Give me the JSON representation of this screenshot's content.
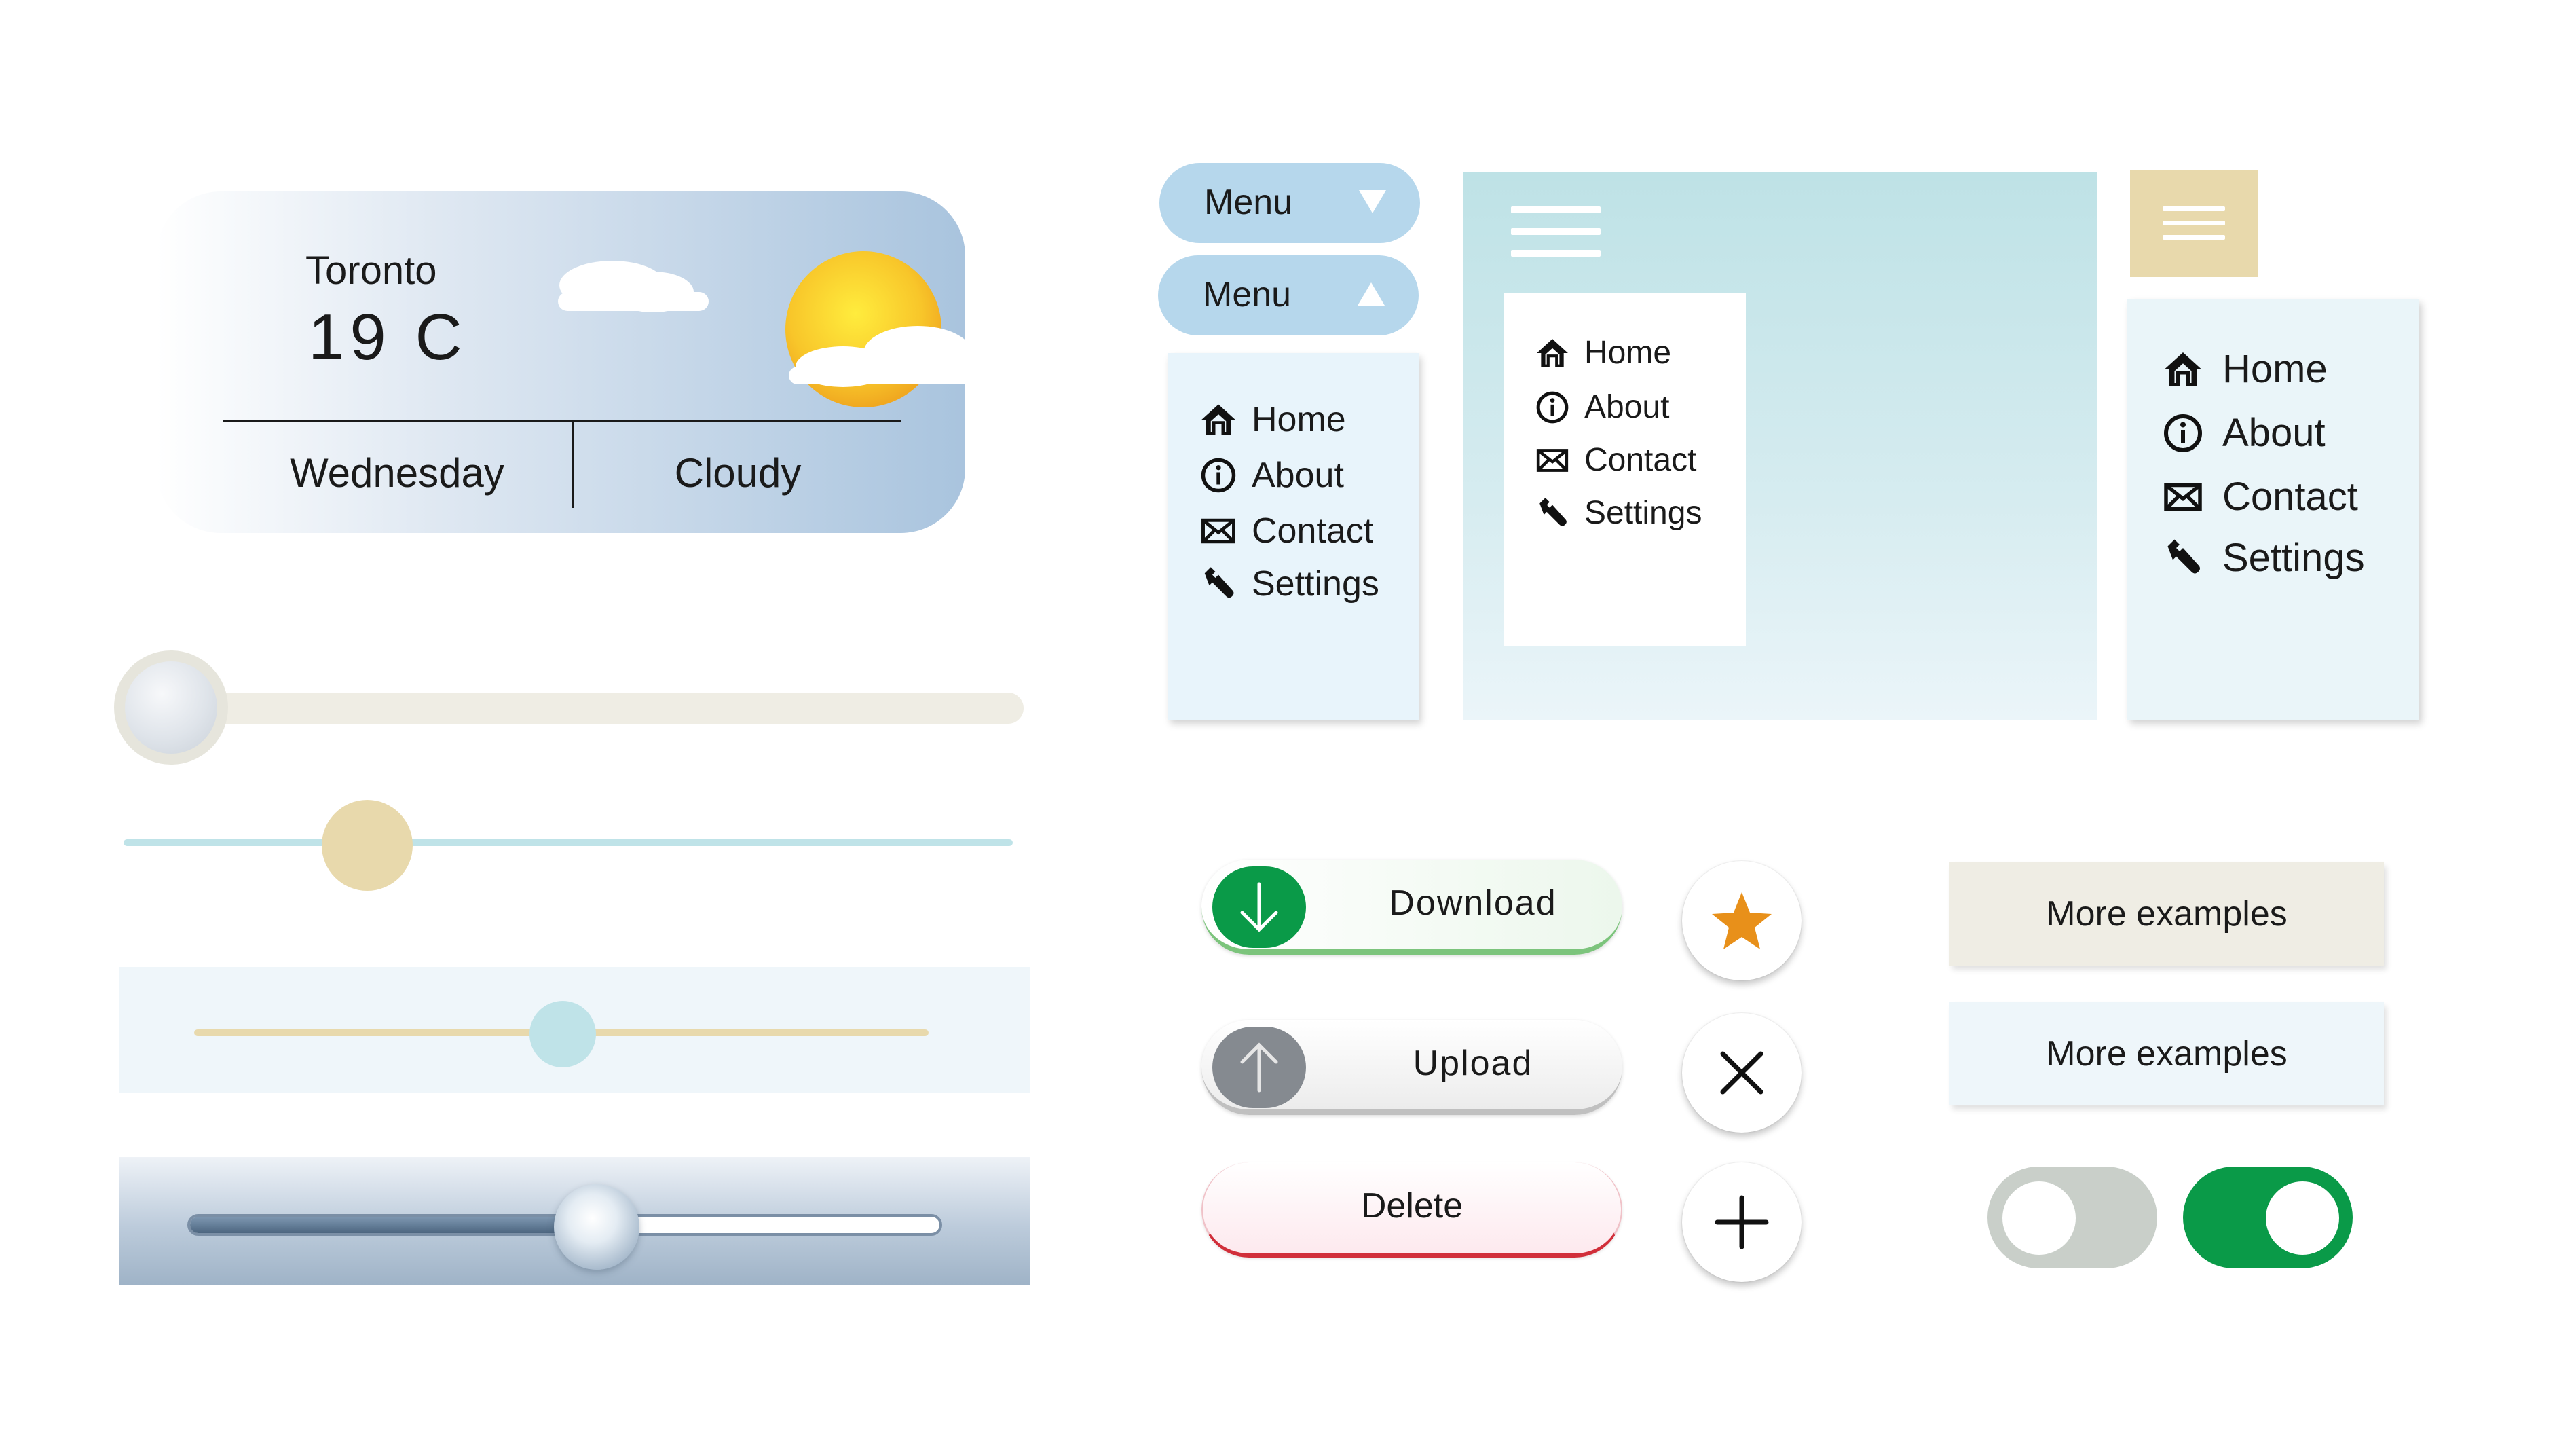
{
  "colors": {
    "weather_gradient_end": "#a9c4de",
    "menu_button": "#b6d7ec",
    "sidebar": "#bee2e6",
    "beige": "#e8d9ac",
    "download_green": "#0a9a48",
    "upload_gray": "#858a90",
    "delete_red": "#d12f3a",
    "star_orange": "#e8901a",
    "toggle_on": "#0a9a48",
    "toggle_off": "#c9cfc9"
  },
  "weather": {
    "city": "Toronto",
    "temperature": "19 C",
    "day": "Wednesday",
    "condition": "Cloudy",
    "icon": "sun-behind-clouds-icon"
  },
  "sliders": [
    {
      "value": 0.0
    },
    {
      "value": 0.25
    },
    {
      "value": 0.48
    },
    {
      "value": 0.48
    }
  ],
  "menu_buttons": [
    {
      "label": "Menu",
      "state": "collapsed",
      "icon": "triangle-down-icon"
    },
    {
      "label": "Menu",
      "state": "expanded",
      "icon": "triangle-up-icon"
    }
  ],
  "menu_items": [
    {
      "label": "Home",
      "icon": "home-icon"
    },
    {
      "label": "About",
      "icon": "info-icon"
    },
    {
      "label": "Contact",
      "icon": "envelope-icon"
    },
    {
      "label": "Settings",
      "icon": "wrench-icon"
    }
  ],
  "hamburger_icon": "hamburger-icon",
  "actions": {
    "download": {
      "label": "Download",
      "icon": "arrow-down-icon"
    },
    "upload": {
      "label": "Upload",
      "icon": "arrow-up-icon"
    },
    "delete": {
      "label": "Delete"
    }
  },
  "round_buttons": {
    "star": "star-icon",
    "close": "close-icon",
    "plus": "plus-icon"
  },
  "more_buttons": [
    {
      "label": "More examples"
    },
    {
      "label": "More examples"
    }
  ],
  "toggles": [
    {
      "on": false
    },
    {
      "on": true
    }
  ]
}
